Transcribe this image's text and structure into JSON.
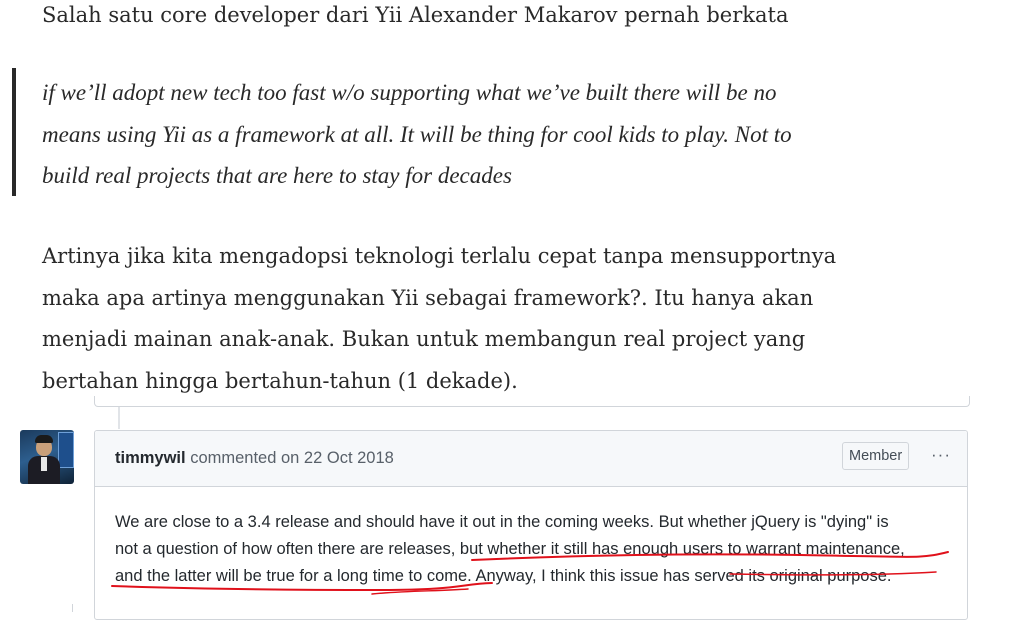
{
  "article": {
    "intro": "Salah satu core developer dari Yii Alexander Makarov pernah berkata",
    "quote_lines": [
      "if we’ll adopt new tech too fast w/o supporting what we’ve built there will be no",
      "means using Yii as a framework at all. It will be thing for cool kids to play. Not to",
      "build real projects that are here to stay for decades"
    ],
    "body_lines": [
      "Artinya jika kita mengadopsi teknologi terlalu cepat tanpa mensupportnya",
      "maka apa artinya menggunakan Yii sebagai framework?. Itu hanya akan",
      "menjadi mainan anak-anak. Bukan untuk membangun real project yang",
      "bertahan hingga bertahun-tahun (1 dekade)."
    ]
  },
  "github_comment": {
    "avatar": "user-avatar",
    "author": "timmywil",
    "action": " commented on 22 Oct 2018",
    "badge": "Member",
    "more_icon": "kebab-horizontal-icon",
    "more_label": "···",
    "body_lines": [
      "We are close to a 3.4 release and should have it out in the coming weeks. But whether jQuery is \"dying\" is",
      "not a question of how often there are releases, but whether it still has enough users to warrant maintenance,",
      "and the latter will be true for a long time to come. Anyway, I think this issue has served its original purpose."
    ]
  },
  "colors": {
    "text": "#292929",
    "gh_border": "#d1d5da",
    "gh_header_bg": "#f6f8fa",
    "annotation": "#e0111b"
  }
}
